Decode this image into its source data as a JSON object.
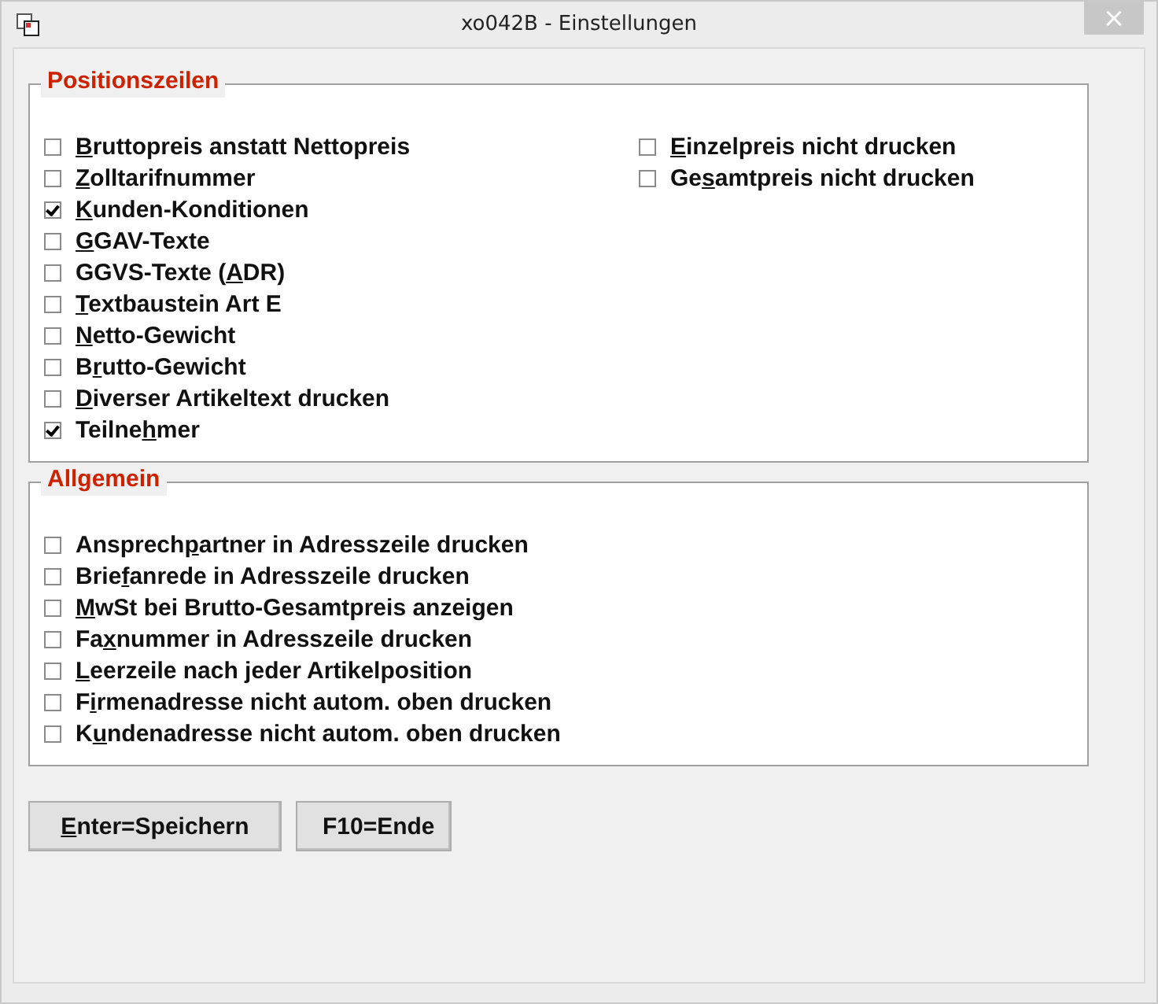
{
  "window": {
    "title": "xo042B - Einstellungen",
    "close": "×"
  },
  "groups": [
    {
      "title": "Positionszeilen",
      "columns": [
        [
          {
            "key": "B",
            "post": "ruttopreis anstatt Nettopreis",
            "checked": false
          },
          {
            "key": "Z",
            "post": "olltarifnummer",
            "checked": false
          },
          {
            "key": "K",
            "post": "unden-Konditionen",
            "checked": true
          },
          {
            "key": "G",
            "post": "GAV-Texte",
            "checked": false
          },
          {
            "pre": "GGVS-Texte (",
            "key": "A",
            "post": "DR)",
            "checked": false
          },
          {
            "key": "T",
            "post": "extbaustein Art E",
            "checked": false
          },
          {
            "key": "N",
            "post": "etto-Gewicht",
            "checked": false
          },
          {
            "pre": "B",
            "key": "r",
            "post": "utto-Gewicht",
            "checked": false
          },
          {
            "key": "D",
            "post": "iverser Artikeltext drucken",
            "checked": false
          },
          {
            "pre": "Teilne",
            "key": "h",
            "post": "mer",
            "checked": true
          }
        ],
        [
          {
            "key": "E",
            "post": "inzelpreis nicht drucken",
            "checked": false
          },
          {
            "pre": "Ge",
            "key": "s",
            "post": "amtpreis nicht drucken",
            "checked": false
          }
        ]
      ]
    },
    {
      "title": "Allgemein",
      "columns": [
        [
          {
            "pre": "Ansprech",
            "key": "p",
            "post": "artner in Adresszeile drucken",
            "checked": false
          },
          {
            "pre": "Brie",
            "key": "f",
            "post": "anrede in Adresszeile drucken",
            "checked": false
          },
          {
            "key": "M",
            "post": "wSt bei Brutto-Gesamtpreis anzeigen",
            "checked": false
          },
          {
            "pre": "Fa",
            "key": "x",
            "post": "nummer in Adresszeile drucken",
            "checked": false
          },
          {
            "key": "L",
            "post": "eerzeile nach jeder Artikelposition",
            "checked": false
          },
          {
            "pre": "F",
            "key": "i",
            "post": "rmenadresse nicht autom. oben drucken",
            "checked": false
          },
          {
            "pre": "K",
            "key": "u",
            "post": "ndenadresse nicht autom. oben drucken",
            "checked": false
          }
        ]
      ]
    }
  ],
  "buttons": [
    {
      "key": "E",
      "post": "nter=Speichern"
    },
    {
      "pre": "F10=Ende"
    }
  ]
}
